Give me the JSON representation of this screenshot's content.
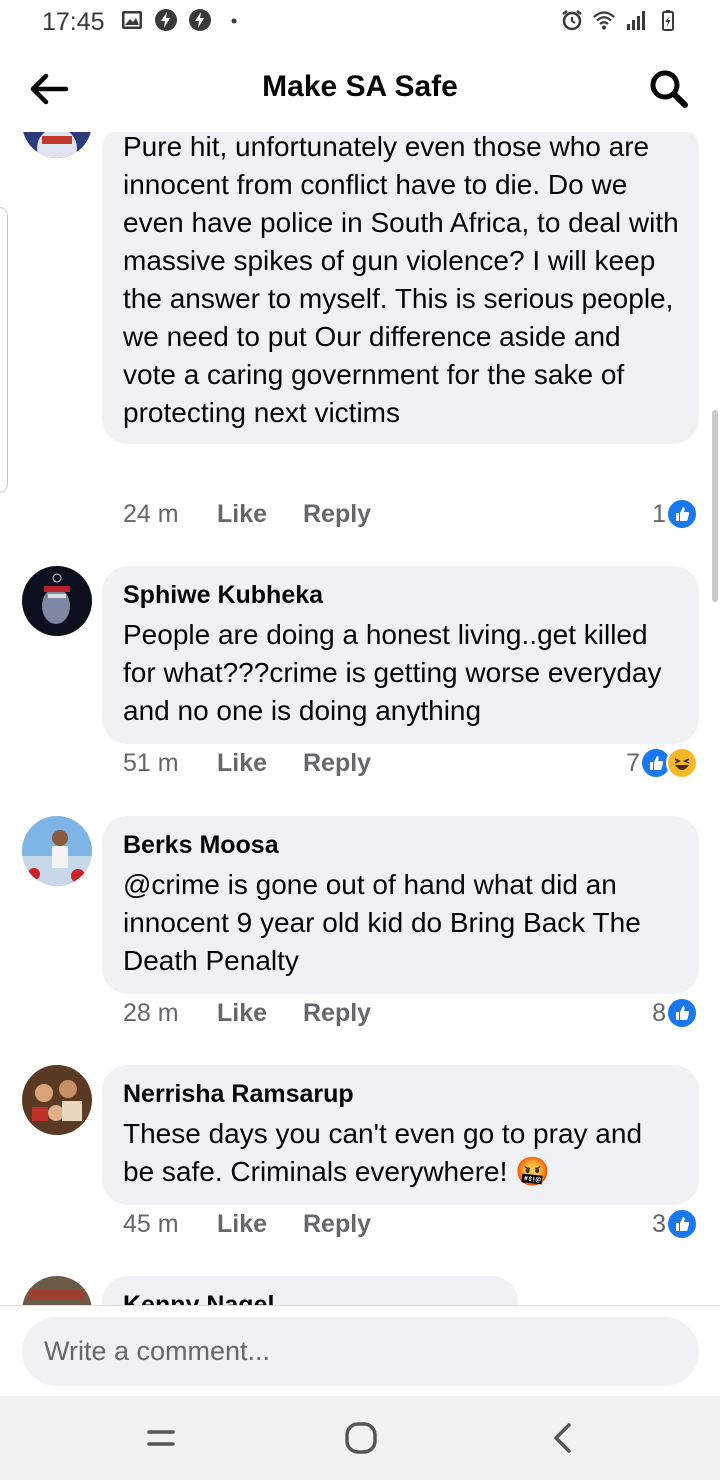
{
  "status_bar": {
    "time": "17:45",
    "left_icons": [
      "gallery-icon",
      "bolt-icon",
      "bolt-icon",
      "dot-icon"
    ],
    "right_icons": [
      "alarm-icon",
      "wifi-icon",
      "signal-icon",
      "battery-icon"
    ]
  },
  "header": {
    "title": "Make SA Safe",
    "back_icon": "arrow-left-icon",
    "search_icon": "search-icon"
  },
  "comments": [
    {
      "author": "",
      "text": "Pure hit, unfortunately even those who are innocent from conflict have to die. Do we even have police in South Africa, to deal with massive spikes of gun violence? I will keep the answer to myself. This is serious people, we need to put Our difference aside and vote a caring government for the sake of protecting next victims",
      "time": "24 m",
      "like_label": "Like",
      "reply_label": "Reply",
      "reaction_count": "1",
      "reactions": [
        "like"
      ]
    },
    {
      "author": "Sphiwe  Kubheka",
      "text": "People are doing a honest living..get killed for what???crime is getting worse everyday and no one is doing anything",
      "time": "51 m",
      "like_label": "Like",
      "reply_label": "Reply",
      "reaction_count": "7",
      "reactions": [
        "like",
        "haha"
      ]
    },
    {
      "author": "Berks Moosa",
      "text": "@crime is gone out of hand  what did an innocent 9 year old kid do Bring Back The Death Penalty",
      "time": "28 m",
      "like_label": "Like",
      "reply_label": "Reply",
      "reaction_count": "8",
      "reactions": [
        "like"
      ]
    },
    {
      "author": "Nerrisha Ramsarup",
      "text": "These days you can't even go to pray and be safe. Criminals everywhere! 🤬",
      "time": "45 m",
      "like_label": "Like",
      "reply_label": "Reply",
      "reaction_count": "3",
      "reactions": [
        "like"
      ]
    },
    {
      "author": "Kenny Nagel",
      "text": ""
    }
  ],
  "composer": {
    "placeholder": "Write a comment..."
  },
  "nav_bar": {
    "icons": [
      "recent-apps-icon",
      "home-icon",
      "back-icon"
    ]
  },
  "colors": {
    "bubble": "#eff1f4",
    "meta_text": "#65676b",
    "like_blue": "#1877f2",
    "haha_yellow": "#f7b928"
  }
}
